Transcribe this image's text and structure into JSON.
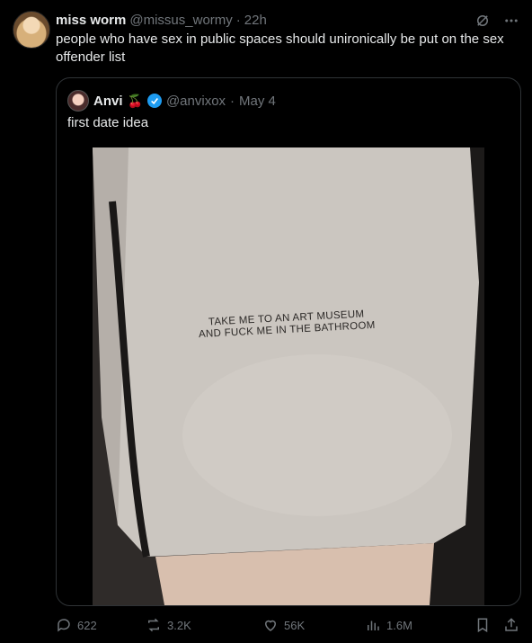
{
  "tweet": {
    "author_name": "miss worm",
    "author_handle": "@missus_wormy",
    "separator": "·",
    "time": "22h",
    "text": "people who have sex in public spaces should unironically be put on the sex offender list"
  },
  "quote": {
    "author_name": "Anvi",
    "name_emoji": "🍒",
    "author_handle": "@anvixox",
    "separator": "·",
    "date": "May 4",
    "text": "first date idea",
    "image_text_line1": "TAKE ME TO AN ART MUSEUM",
    "image_text_line2": "AND FUCK ME IN THE BATHROOM"
  },
  "actions": {
    "replies": "622",
    "reposts": "3.2K",
    "likes": "56K",
    "views": "1.6M"
  },
  "icons": [
    "grok-icon",
    "more-icon",
    "verified-icon",
    "reply-icon",
    "repost-icon",
    "like-icon",
    "views-icon",
    "bookmark-icon",
    "share-icon"
  ],
  "colors": {
    "background": "#000000",
    "text": "#e7e9ea",
    "muted": "#71767b",
    "verified": "#1d9bf0",
    "border": "#2f3336"
  }
}
